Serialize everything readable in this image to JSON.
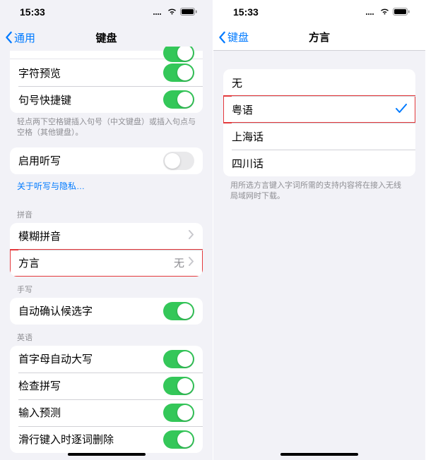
{
  "left": {
    "time": "15:33",
    "back": "通用",
    "title": "键盘",
    "rows1": {
      "char_preview": "字符预览",
      "period_shortcut": "句号快捷键"
    },
    "footer1": "轻点两下空格键插入句号（中文键盘）或插入句点与空格（其他键盘）。",
    "dictation": "启用听写",
    "dictation_link": "关于听写与隐私…",
    "section_pinyin": "拼音",
    "fuzzy": "模糊拼音",
    "dialect": "方言",
    "dialect_value": "无",
    "section_hand": "手写",
    "auto_confirm": "自动确认候选字",
    "section_en": "英语",
    "en_caps": "首字母自动大写",
    "en_spell": "检查拼写",
    "en_predict": "输入预测",
    "en_slide": "滑行键入时逐词删除"
  },
  "right": {
    "time": "15:33",
    "back": "键盘",
    "title": "方言",
    "options": {
      "none": "无",
      "yue": "粤语",
      "sh": "上海话",
      "sc": "四川话"
    },
    "footer": "用所选方言键入字词所需的支持内容将在接入无线局域网时下载。"
  }
}
